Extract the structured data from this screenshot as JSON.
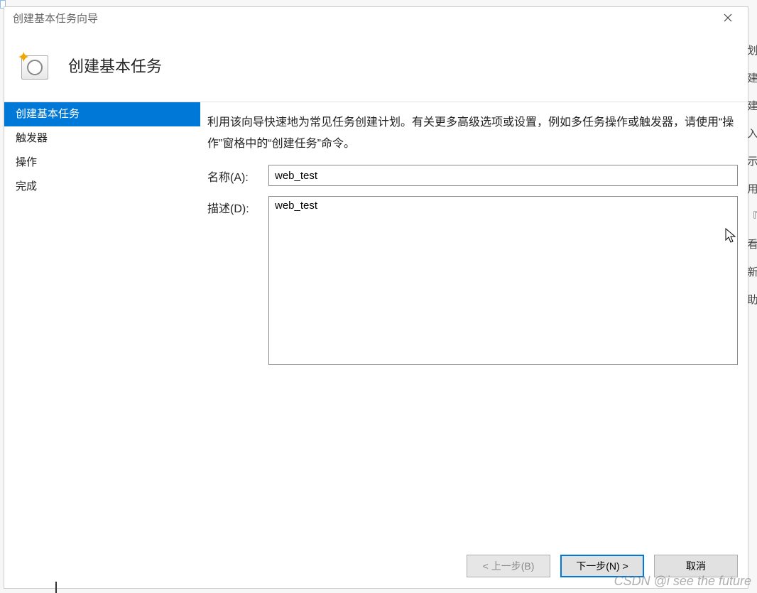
{
  "dialog": {
    "title": "创建基本任务向导",
    "heading": "创建基本任务"
  },
  "sidebar": {
    "items": [
      {
        "label": "创建基本任务",
        "selected": true
      },
      {
        "label": "触发器",
        "selected": false
      },
      {
        "label": "操作",
        "selected": false
      },
      {
        "label": "完成",
        "selected": false
      }
    ]
  },
  "main": {
    "intro_text": "利用该向导快速地为常见任务创建计划。有关更多高级选项或设置，例如多任务操作或触发器，请使用“操作”窗格中的“创建任务”命令。",
    "name_label": "名称(A):",
    "name_value": "web_test",
    "desc_label": "描述(D):",
    "desc_value": "web_test"
  },
  "buttons": {
    "back": "< 上一步(B)",
    "next": "下一步(N) >",
    "cancel": "取消"
  },
  "right_strip": [
    "划",
    "建",
    "建",
    "入",
    "示",
    "用",
    "『",
    "看",
    "新",
    "助"
  ],
  "watermark": "CSDN @i see the future"
}
